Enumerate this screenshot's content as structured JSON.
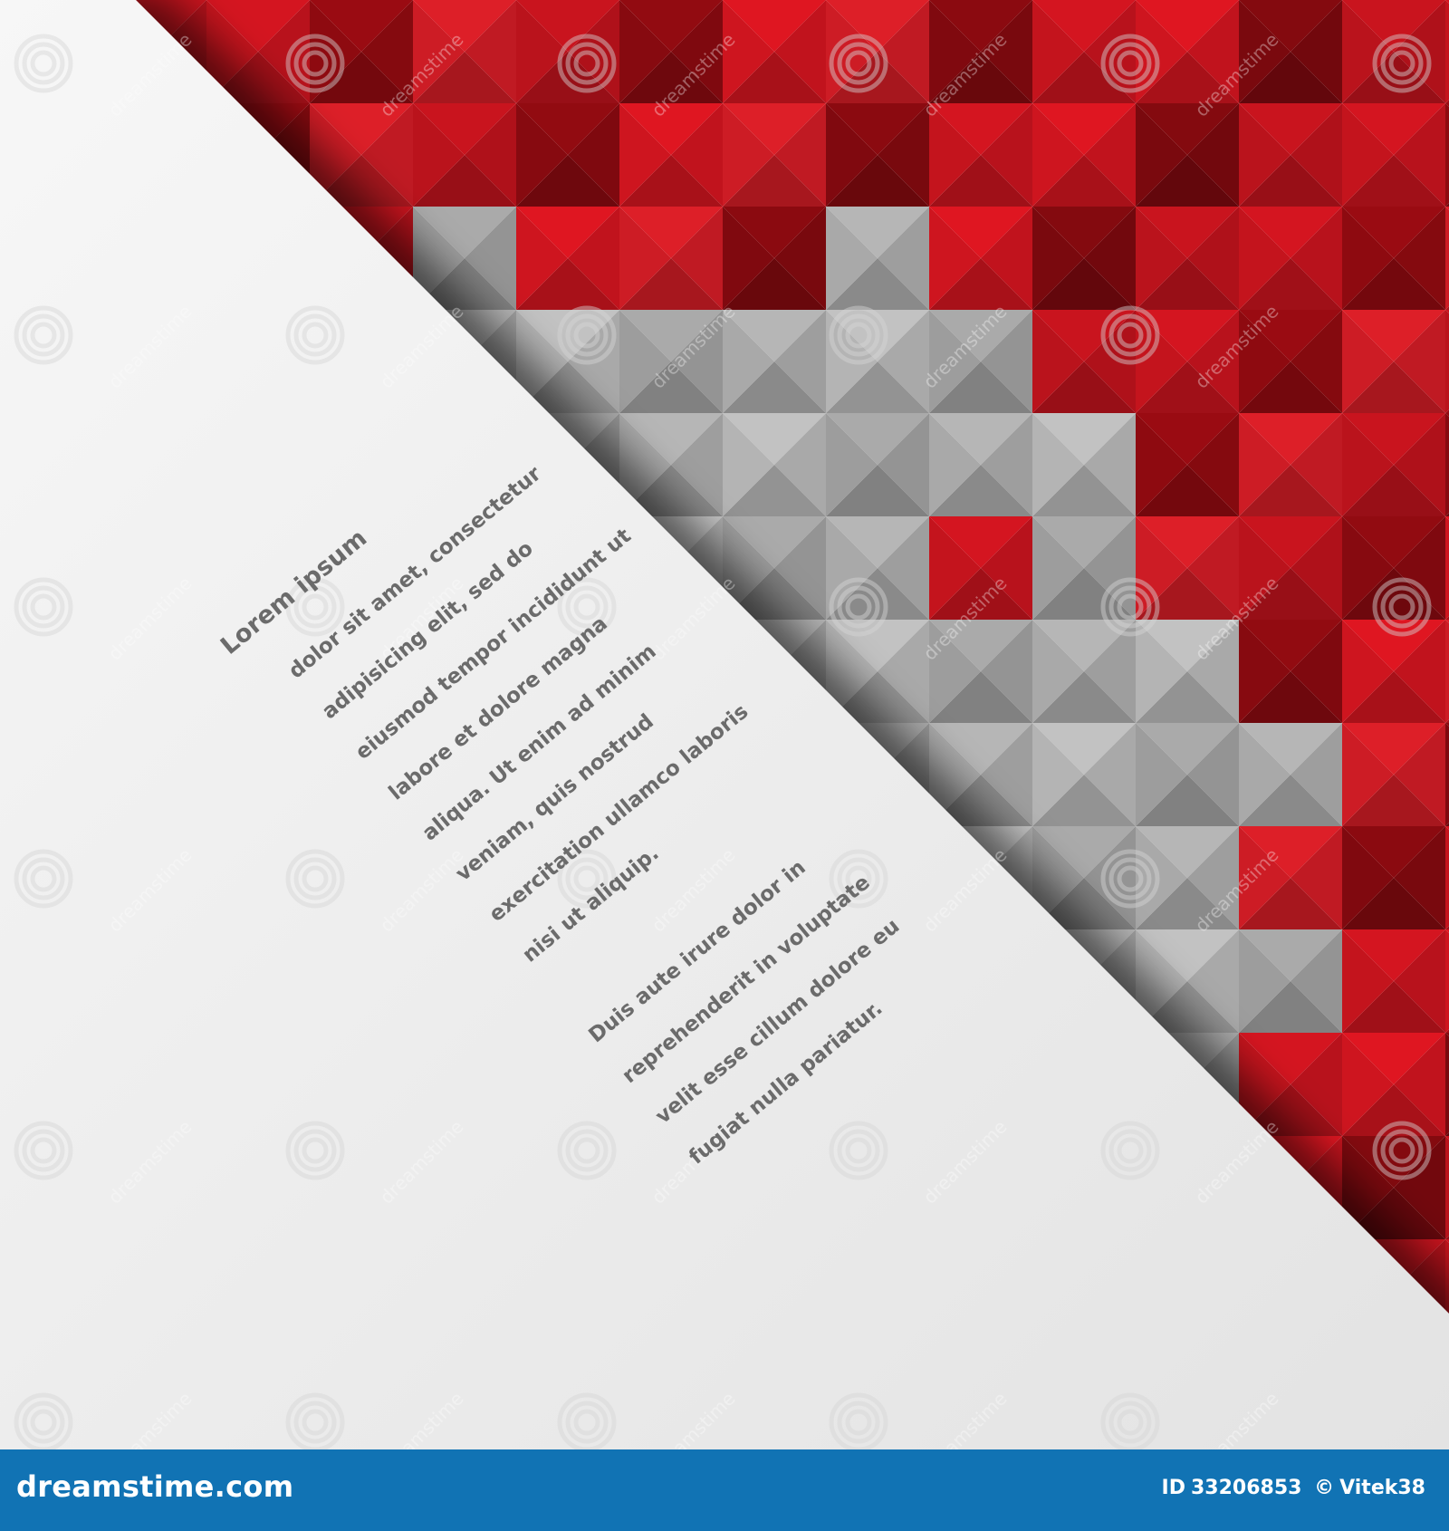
{
  "artwork": {
    "title": "Lorem ipsum",
    "paragraphs": [
      [
        "dolor sit amet, consectetur",
        "adipisicing elit, sed do",
        "eiusmod tempor incididunt ut",
        "labore et dolore magna",
        "aliqua. Ut enim ad minim",
        "veniam, quis nostrud",
        "exercitation ullamco laboris",
        "nisi ut aliquip."
      ],
      [
        "Duis aute irure dolor in",
        "reprehenderit in voluptate",
        "velit esse cillum dolore eu",
        "fugiat nulla pariatur."
      ]
    ],
    "watermark_text": "dreamstime",
    "colors": {
      "red_light": "#e8202a",
      "red_mid": "#c8141e",
      "red_dark": "#8a0a10",
      "grey_light": "#bdbdbd",
      "grey_dark": "#6c6c6c",
      "paper": "#f3f3f3"
    }
  },
  "footer": {
    "brand": "dreamstime.com",
    "id_label": "ID",
    "id_value": "33206853",
    "copyright_symbol": "©",
    "author": "Vitek38",
    "background_color": "#1173b4"
  }
}
